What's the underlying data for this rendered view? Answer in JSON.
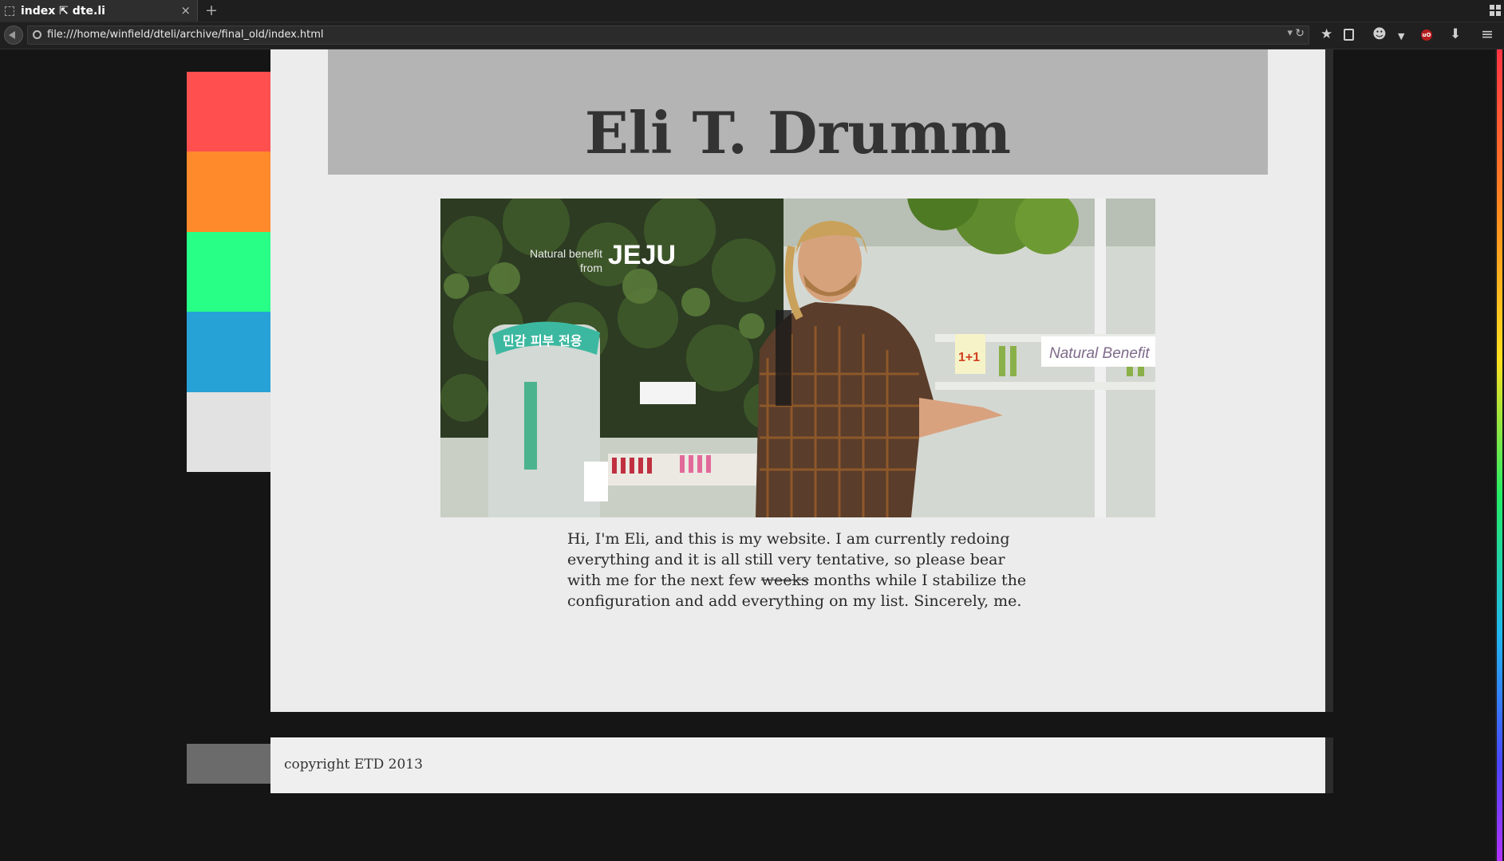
{
  "browser": {
    "tab_title": "index ⇱ dte.li",
    "close_glyph": "×",
    "new_tab_glyph": "+",
    "url": "file:///home/winfield/dteli/archive/final_old/index.html",
    "toolbar": {
      "bookmark_icon": "star-icon",
      "reader_icon": "reader-icon",
      "privacy_icon": "ghost-icon",
      "ublock_label": "uO",
      "download_icon": "download-icon",
      "menu_icon": "hamburger-icon"
    }
  },
  "page": {
    "title": "Eli T. Drumm",
    "intro_before": "Hi, I'm Eli, and this is my website. I am currently redoing everything and it is all still very tentative, so please bear with me for the next few ",
    "intro_struck": "weeks",
    "intro_after": " months while I stabilize the configuration and add everything on my list. Sincerely, me.",
    "photo_signs": {
      "jeju_small": "Natural benefit",
      "jeju_from": "from",
      "jeju_big": "JEJU",
      "display_sign": "민감 피부 전용",
      "right_sign": "Natural Benefit",
      "promo": "1+1"
    },
    "footer": "copyright ETD 2013"
  },
  "colors": {
    "stripes": [
      "#ff4f4f",
      "#ff8a2b",
      "#27ff87",
      "#27a2d6",
      "#e2e2e2"
    ],
    "footer_stripe": "#6b6b6b",
    "header_band": "#b4b4b4",
    "card": "#ececec"
  }
}
